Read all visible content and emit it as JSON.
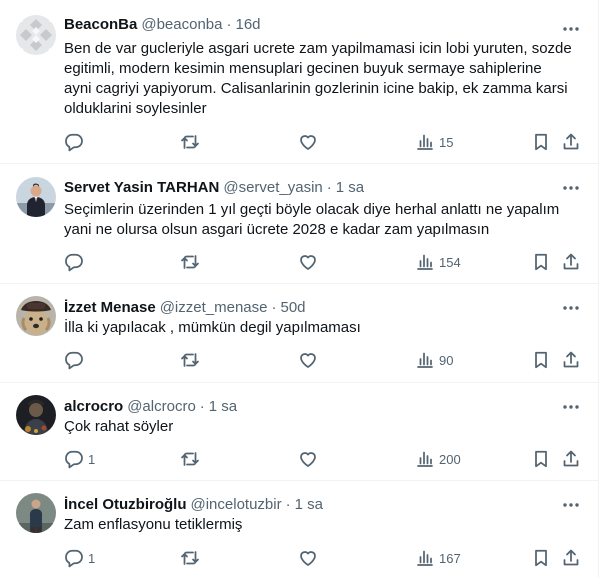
{
  "tweets": [
    {
      "name": "BeaconBa",
      "handle": "@beaconba",
      "separator": "·",
      "time": "16d",
      "text_lines": [
        "Ben de var gucleriyle asgari ucrete zam yapilmamasi icin lobi yuruten, sozde",
        "egitimli, modern kesimin mensuplari gecinen buyuk sermaye sahiplerine",
        "ayni cagriyi yapiyorum. Calisanlarinin gozlerinin icine bakip, ek zamma karsi",
        "olduklarini soylesinler"
      ],
      "replies": "",
      "reposts": "",
      "likes": "",
      "views": "15",
      "avatar_icon": "grey-geometric-pattern-avatar"
    },
    {
      "name": "Servet Yasin TARHAN",
      "handle": "@servet_yasin",
      "separator": "·",
      "time": "1 sa",
      "text_lines": [
        "Seçimlerin üzerinden 1 yıl geçti böyle olacak diye herhal anlattı ne yapalım",
        "yani ne olursa olsun asgari ücrete 2028 e kadar zam yapılmasın"
      ],
      "replies": "",
      "reposts": "",
      "likes": "",
      "views": "154",
      "avatar_icon": "man-in-suit-photo-avatar"
    },
    {
      "name": "İzzet Menase",
      "handle": "@izzet_menase",
      "separator": "·",
      "time": "50d",
      "text_lines": [
        "İlla ki yapılacak , mümkün degil yapılmaması"
      ],
      "replies": "",
      "reposts": "",
      "likes": "",
      "views": "90",
      "avatar_icon": "dog-with-hat-avatar"
    },
    {
      "name": "alcrocro",
      "handle": "@alcrocro",
      "separator": "·",
      "time": "1 sa",
      "text_lines": [
        "Çok rahat söyler"
      ],
      "replies": "1",
      "reposts": "",
      "likes": "",
      "views": "200",
      "avatar_icon": "dark-artwork-avatar"
    },
    {
      "name": "İncel Otuzbiroğlu",
      "handle": "@incelotuzbir",
      "separator": "·",
      "time": "1 sa",
      "text_lines": [
        "Zam enflasyonu tetiklermiş"
      ],
      "replies": "1",
      "reposts": "",
      "likes": "",
      "views": "167",
      "avatar_icon": "standing-figure-avatar"
    }
  ],
  "colors": {
    "text_primary": "#0f1419",
    "text_secondary": "#536471",
    "divider": "#eff3f4",
    "background": "#ffffff"
  }
}
